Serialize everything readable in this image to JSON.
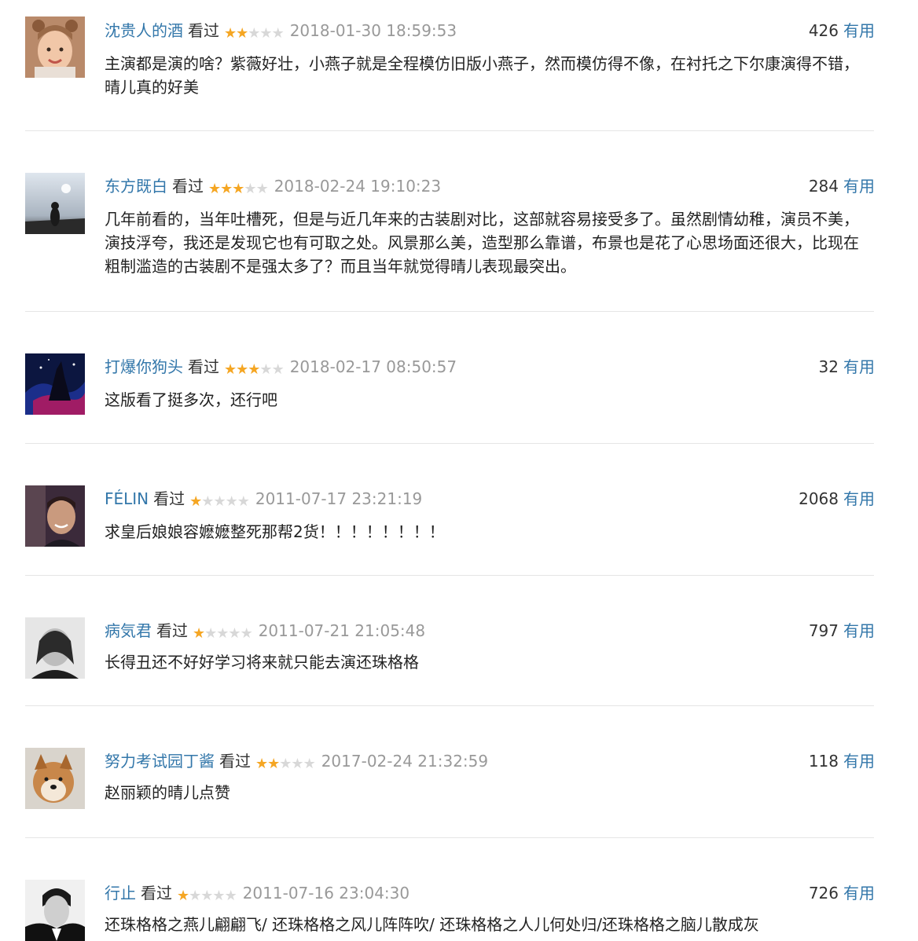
{
  "comments": [
    {
      "user": "沈贵人的酒",
      "status": "看过",
      "rating": 2,
      "time": "2018-01-30 18:59:53",
      "votes": "426",
      "useful_label": "有用",
      "text": "主演都是演的啥？紫薇好壮，小燕子就是全程模仿旧版小燕子，然而模仿得不像，在衬托之下尔康演得不错，晴儿真的好美"
    },
    {
      "user": "东方既白",
      "status": "看过",
      "rating": 3,
      "time": "2018-02-24 19:10:23",
      "votes": "284",
      "useful_label": "有用",
      "text": "几年前看的，当年吐槽死，但是与近几年来的古装剧对比，这部就容易接受多了。虽然剧情幼稚，演员不美，演技浮夸，我还是发现它也有可取之处。风景那么美，造型那么靠谱，布景也是花了心思场面还很大，比现在粗制滥造的古装剧不是强太多了？而且当年就觉得晴儿表现最突出。"
    },
    {
      "user": "打爆你狗头",
      "status": "看过",
      "rating": 3,
      "time": "2018-02-17 08:50:57",
      "votes": "32",
      "useful_label": "有用",
      "text": "这版看了挺多次，还行吧"
    },
    {
      "user": "FÉLIN",
      "status": "看过",
      "rating": 1,
      "time": "2011-07-17 23:21:19",
      "votes": "2068",
      "useful_label": "有用",
      "text": "求皇后娘娘容嬷嬷整死那帮2货！！！！！！！！"
    },
    {
      "user": "病気君",
      "status": "看过",
      "rating": 1,
      "time": "2011-07-21 21:05:48",
      "votes": "797",
      "useful_label": "有用",
      "text": "长得丑还不好好学习将来就只能去演还珠格格"
    },
    {
      "user": "努力考试园丁酱",
      "status": "看过",
      "rating": 2,
      "time": "2017-02-24 21:32:59",
      "votes": "118",
      "useful_label": "有用",
      "text": "赵丽颖的晴儿点赞"
    },
    {
      "user": "行止",
      "status": "看过",
      "rating": 1,
      "time": "2011-07-16 23:04:30",
      "votes": "726",
      "useful_label": "有用",
      "text": "还珠格格之燕儿翩翩飞/ 还珠格格之风儿阵阵吹/ 还珠格格之人儿何处归/还珠格格之脑儿散成灰"
    }
  ],
  "colors": {
    "link": "#3377aa",
    "star_on": "#f5a623",
    "star_off": "#d8d8d8",
    "time": "#999999",
    "divider": "#e5e5e5"
  }
}
